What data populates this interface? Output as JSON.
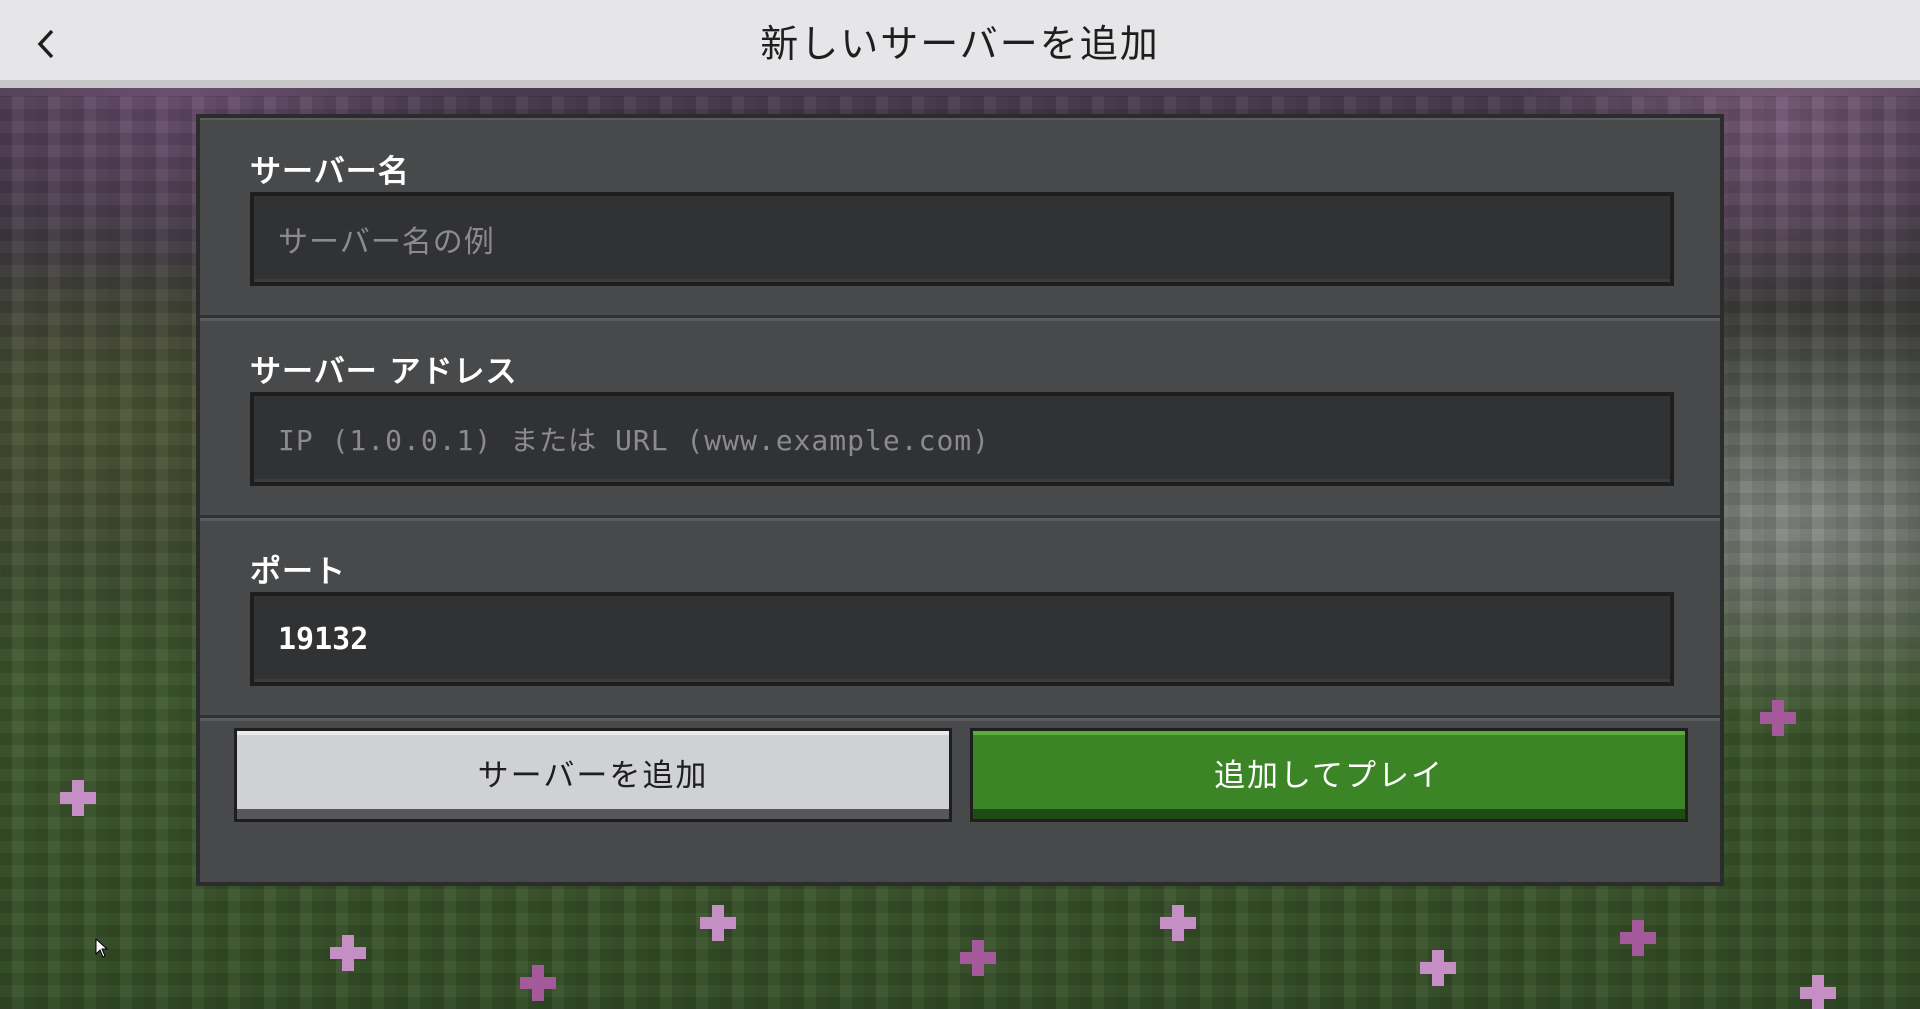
{
  "header": {
    "title": "新しいサーバーを追加",
    "back_icon": "chevron-left-icon"
  },
  "form": {
    "server_name": {
      "label": "サーバー名",
      "placeholder": "サーバー名の例",
      "value": ""
    },
    "server_address": {
      "label": "サーバー アドレス",
      "placeholder": "IP (1.0.0.1) または URL (www.example.com)",
      "value": ""
    },
    "port": {
      "label": "ポート",
      "value": "19132"
    }
  },
  "actions": {
    "add_server_label": "サーバーを追加",
    "add_and_play_label": "追加してプレイ"
  },
  "colors": {
    "topbar": "#e6e6e8",
    "panel": "#48494a",
    "field": "#313233",
    "primary_button": "#3c8527",
    "secondary_button": "#d0d1d4"
  }
}
